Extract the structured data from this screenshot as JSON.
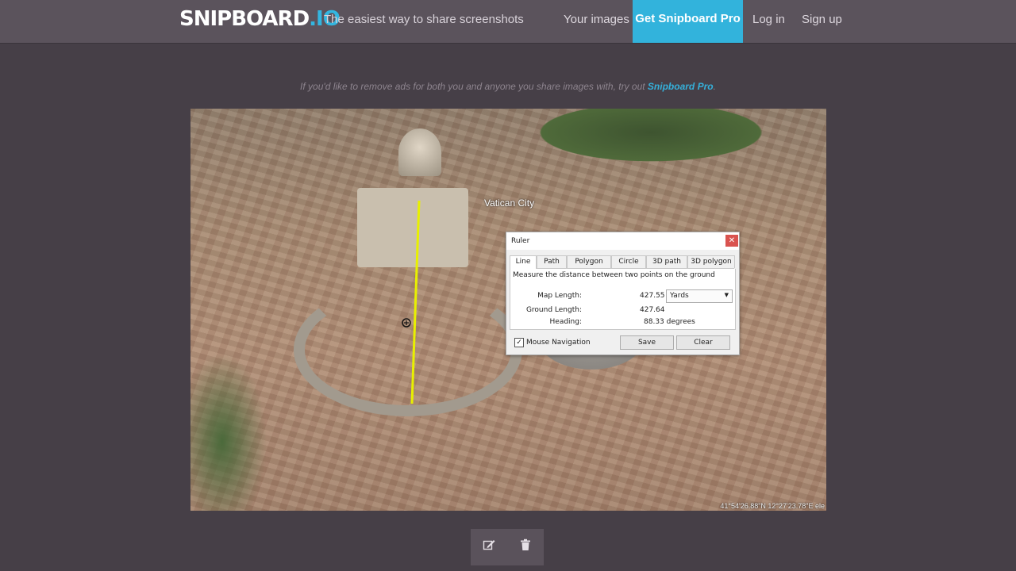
{
  "header": {
    "logo_main": "SNIPBOARD",
    "logo_tld": ".IO",
    "tagline": "The easiest way to share screenshots",
    "nav": {
      "your_images": "Your images",
      "get_pro": "Get Snipboard Pro",
      "login": "Log in",
      "signup": "Sign up"
    }
  },
  "ad_note": {
    "text": "If you'd like to remove ads for both you and anyone you share images with, try out ",
    "link": "Snipboard Pro",
    "end": "."
  },
  "image": {
    "map_label": "Vatican City",
    "coords": "41°54'26.88\"N  12°27'23.78\"E  ele",
    "ruler": {
      "title": "Ruler",
      "tabs": [
        "Line",
        "Path",
        "Polygon",
        "Circle",
        "3D path",
        "3D polygon"
      ],
      "active_tab": "Line",
      "description": "Measure the distance between two points on the ground",
      "map_length_label": "Map Length:",
      "map_length_value": "427.55",
      "unit": "Yards",
      "ground_length_label": "Ground Length:",
      "ground_length_value": "427.64",
      "heading_label": "Heading:",
      "heading_value": "88.33 degrees",
      "mouse_nav_label": "Mouse Navigation",
      "mouse_nav_checked": true,
      "save_label": "Save",
      "clear_label": "Clear"
    }
  },
  "toolbar": {
    "edit_icon": "pencil-edit-icon",
    "delete_icon": "trash-icon"
  },
  "colors": {
    "accent": "#32b3dc",
    "background": "#463f47",
    "header": "#5b535c",
    "measure_line": "#e8f000"
  }
}
